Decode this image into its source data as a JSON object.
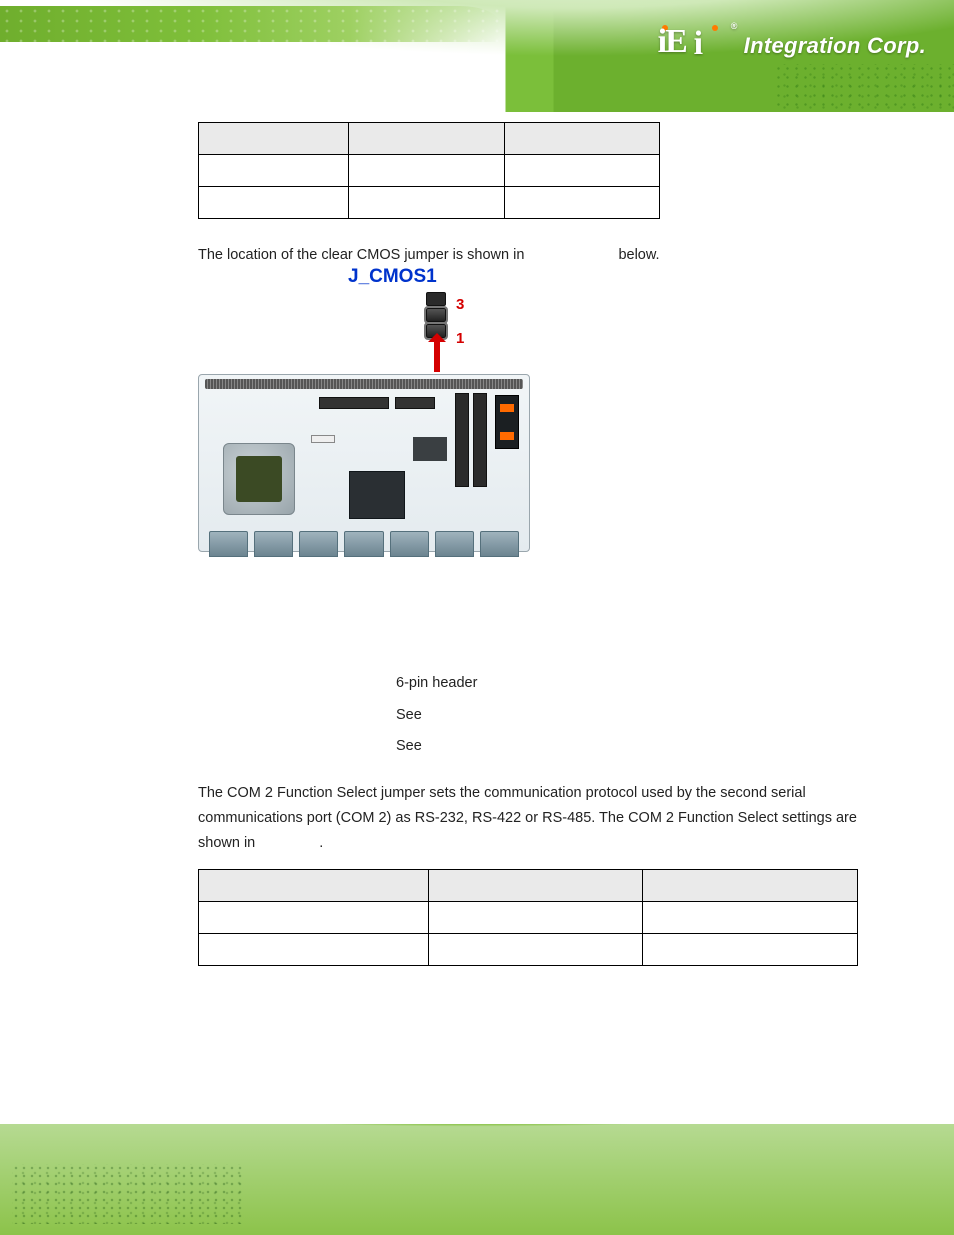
{
  "brand": {
    "name": "iEi",
    "tagline": "Integration Corp."
  },
  "table1": {
    "headers": [
      "",
      "",
      ""
    ],
    "rows": [
      [
        "",
        "",
        ""
      ],
      [
        "",
        "",
        ""
      ]
    ]
  },
  "table1_caption": "",
  "paragraph1_a": "The location of the clear CMOS jumper is shown in ",
  "paragraph1_b": " below.",
  "figure": {
    "jumper_label": "J_CMOS1",
    "pin_top": "3",
    "pin_bottom": "1",
    "caption": ""
  },
  "info": {
    "type_label": "",
    "type_value": "6-pin header",
    "loc_label": "",
    "loc_value": "See ",
    "set_label": "",
    "set_value": "See "
  },
  "paragraph2": "The COM 2 Function Select jumper sets the communication protocol used by the second serial communications port (COM 2) as RS-232, RS-422 or RS-485. The COM 2 Function Select settings are shown in ",
  "paragraph2_tail": ".",
  "table2": {
    "headers": [
      "",
      "",
      ""
    ],
    "rows": [
      [
        "",
        "",
        ""
      ],
      [
        "",
        "",
        ""
      ]
    ]
  },
  "page_number": ""
}
